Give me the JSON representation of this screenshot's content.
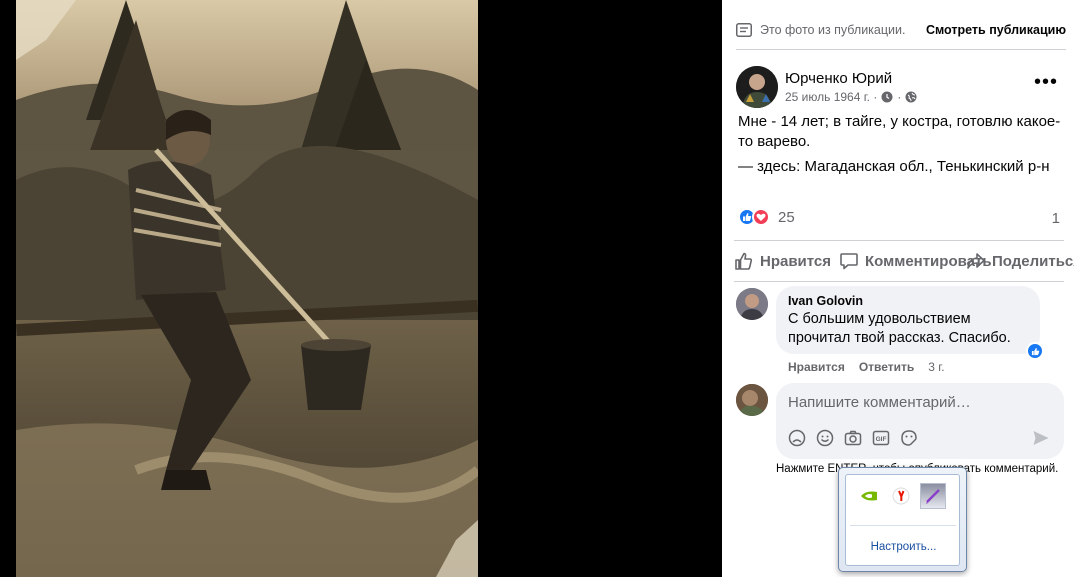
{
  "topbar": {
    "from_text": "Это фото из публикации.",
    "view_label": "Смотреть публикацию"
  },
  "author": {
    "name": "Юрченко Юрий",
    "date": "25 июль 1964 г. ·"
  },
  "post": {
    "text": "Мне - 14 лет; в тайге, у костра, готовлю какое-то варево.",
    "place_prefix": "— здесь:",
    "place_name": "Магаданская обл., Тенькинский р-н"
  },
  "reactions": {
    "count": "25",
    "comments": "1"
  },
  "actions": {
    "like": "Нравится",
    "comment": "Комментировать",
    "share": "Поделиться"
  },
  "comment": {
    "author": "Ivan Golovin",
    "text": "С большим удовольствием прочитал твой рассказ. Спасибо.",
    "like": "Нравится",
    "reply": "Ответить",
    "time": "3 г."
  },
  "compose": {
    "placeholder": "Напишите комментарий…",
    "hint": "Нажмите ENTER, чтобы опубликовать комментарий."
  },
  "tray": {
    "configure": "Настроить..."
  },
  "colors": {
    "accent": "#1877f2",
    "love": "#f33e58",
    "secondary_text": "#65676b",
    "bubble": "#f0f2f5"
  }
}
